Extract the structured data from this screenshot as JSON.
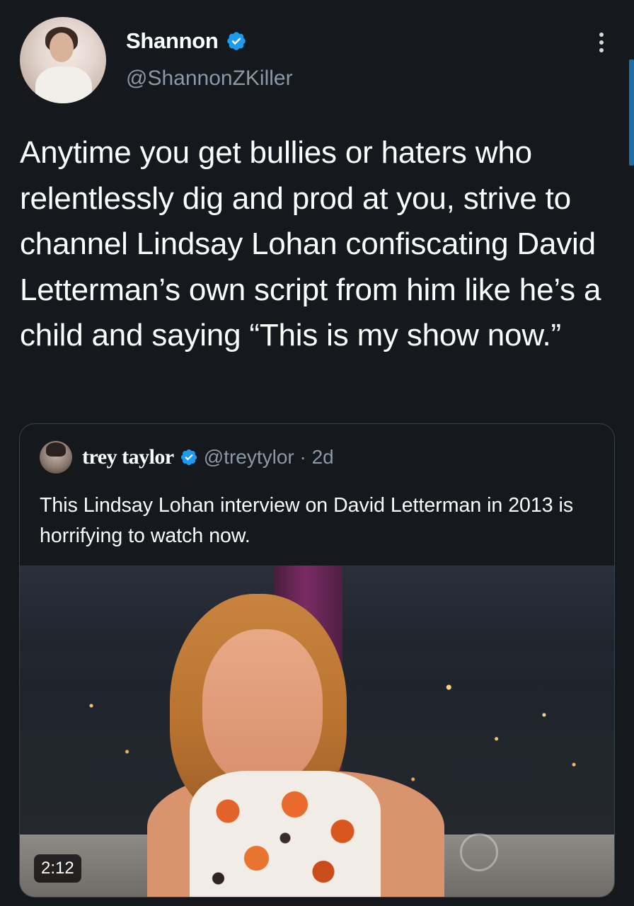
{
  "tweet": {
    "display_name": "Shannon",
    "handle": "@ShannonZKiller",
    "text": "Anytime you get bullies or haters who relentlessly dig and prod at you, strive to channel Lindsay Lohan confiscating David Letterman’s own script from him like he’s a child and saying “This is my show now.”"
  },
  "quoted_tweet": {
    "display_name": "trey taylor",
    "handle_time": "@treytylor · 2d",
    "text": "This Lindsay Lohan interview on David Letterman in 2013 is horrifying to watch now.",
    "video": {
      "duration": "2:12"
    }
  },
  "icons": {
    "verified": "verified-badge-icon",
    "more": "more-vertical-icon"
  },
  "colors": {
    "background": "#15181c",
    "verified_blue": "#1d9bf0",
    "secondary_text": "#8b98a5",
    "card_border": "#38444d"
  }
}
